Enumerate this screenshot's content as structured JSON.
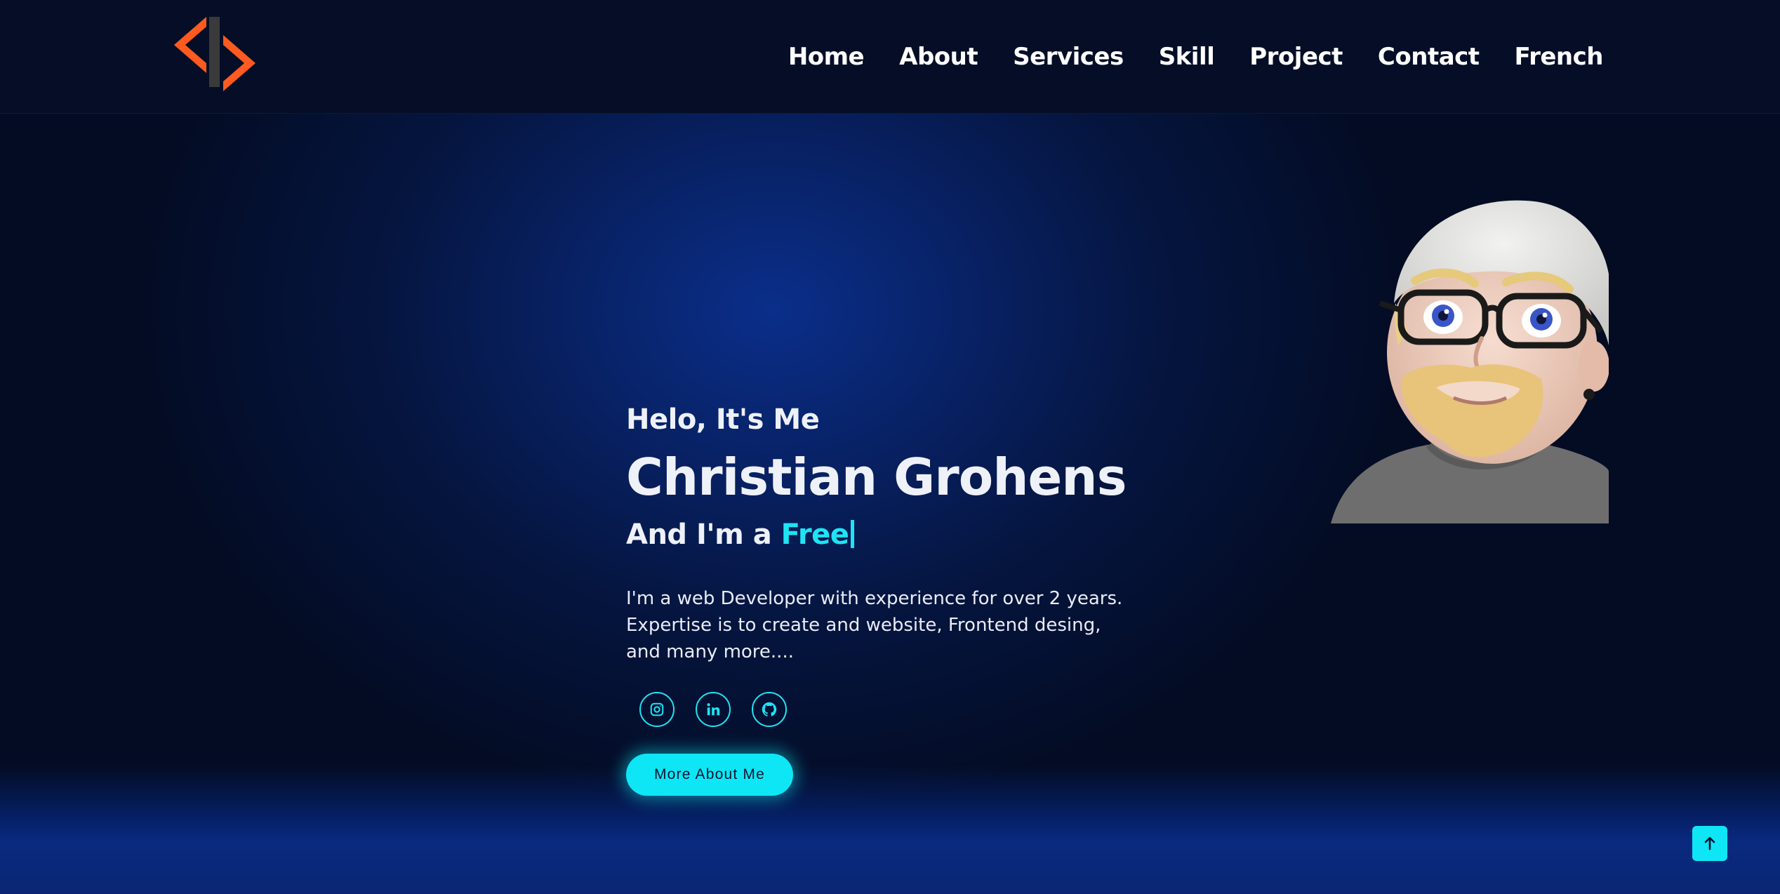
{
  "header": {
    "logo_icon": "code-brackets-logo-icon",
    "nav": [
      {
        "label": "Home"
      },
      {
        "label": "About"
      },
      {
        "label": "Services"
      },
      {
        "label": "Skill"
      },
      {
        "label": "Project"
      },
      {
        "label": "Contact"
      },
      {
        "label": "French"
      }
    ]
  },
  "hero": {
    "greeting": "Helo, It's Me",
    "name": "Christian Grohens",
    "role_prefix": "And I'm a ",
    "role_typed": "Free",
    "description": "I'm a web Developer with experience for over 2 years. Expertise is to create and website, Frontend desing, and many more....",
    "socials": [
      {
        "icon": "instagram-icon"
      },
      {
        "icon": "linkedin-icon"
      },
      {
        "icon": "github-icon"
      }
    ],
    "cta_label": "More About Me",
    "avatar_icon": "memoji-avatar-icon"
  },
  "scroll_top_icon": "arrow-up-icon",
  "colors": {
    "accent": "#0ee6f5",
    "logo_orange": "#ff5a1f",
    "background": "#040c24",
    "hero_blue": "#0a2e8a"
  }
}
